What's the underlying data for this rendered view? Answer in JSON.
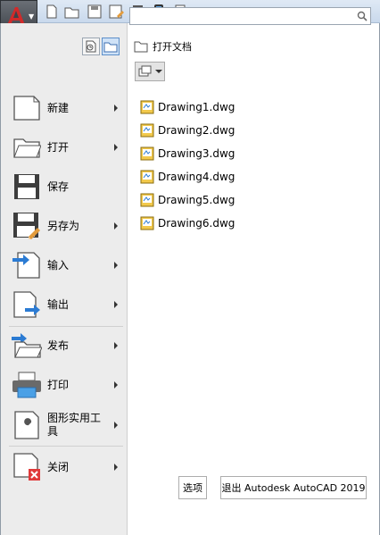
{
  "menu": {
    "search": {
      "value": "",
      "placeholder": ""
    },
    "items": [
      {
        "label": "新建",
        "icon": "new-document-icon",
        "has_submenu": true
      },
      {
        "label": "打开",
        "icon": "open-folder-icon",
        "has_submenu": true
      },
      {
        "label": "保存",
        "icon": "save-disk-icon",
        "has_submenu": false
      },
      {
        "label": "另存为",
        "icon": "save-as-icon",
        "has_submenu": true
      },
      {
        "label": "输入",
        "icon": "import-icon",
        "has_submenu": true
      },
      {
        "label": "输出",
        "icon": "export-icon",
        "has_submenu": true
      },
      {
        "label": "发布",
        "icon": "publish-icon",
        "has_submenu": true
      },
      {
        "label": "打印",
        "icon": "printer-icon",
        "has_submenu": true
      },
      {
        "label": "图形实用工具",
        "icon": "drawing-utilities-icon",
        "has_submenu": true
      },
      {
        "label": "关闭",
        "icon": "close-document-icon",
        "has_submenu": true
      }
    ],
    "panel_title": "打开文档",
    "documents": [
      {
        "name": "Drawing1.dwg"
      },
      {
        "name": "Drawing2.dwg"
      },
      {
        "name": "Drawing3.dwg"
      },
      {
        "name": "Drawing4.dwg"
      },
      {
        "name": "Drawing5.dwg"
      },
      {
        "name": "Drawing6.dwg"
      }
    ],
    "options_button": "选项",
    "exit_button": "退出 Autodesk AutoCAD 2019"
  },
  "colors": {
    "accent": "#2b7bd3",
    "logo_red": "#d12a2a",
    "close_red": "#e03a3a"
  }
}
